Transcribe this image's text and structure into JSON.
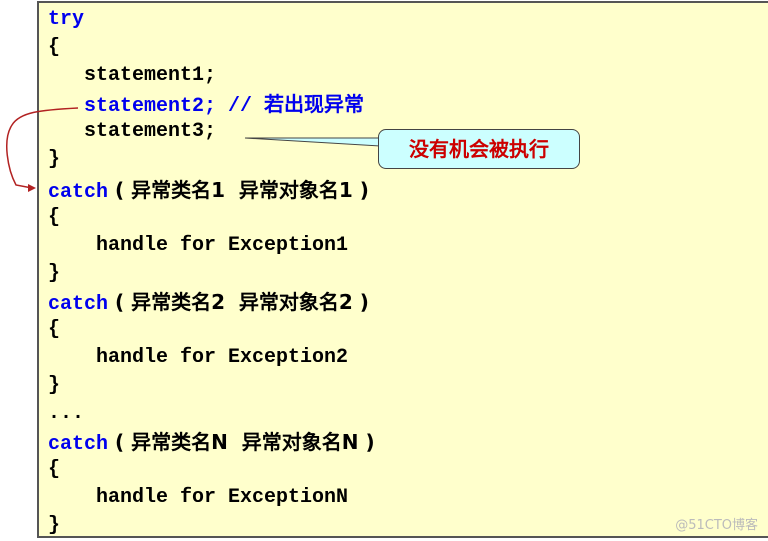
{
  "code": {
    "lines": [
      {
        "text": "try",
        "style": "keyword"
      },
      {
        "text": "{"
      },
      {
        "text": "   statement1;"
      },
      {
        "text": "   statement2; // ",
        "comment": "若出现异常",
        "style": "highlight"
      },
      {
        "text": "   statement3;"
      },
      {
        "text": "}"
      },
      {
        "kw": "catch",
        "rest": " ( 异常类名1  异常对象名1 )"
      },
      {
        "text": "{"
      },
      {
        "text": "    handle for Exception1"
      },
      {
        "text": "}"
      },
      {
        "kw": "catch",
        "rest": " ( 异常类名2  异常对象名2 )"
      },
      {
        "text": "{"
      },
      {
        "text": "    handle for Exception2"
      },
      {
        "text": "}"
      },
      {
        "text": "..."
      },
      {
        "kw": "catch",
        "rest": " ( 异常类名N  异常对象名N )"
      },
      {
        "text": "{"
      },
      {
        "text": "    handle for ExceptionN"
      },
      {
        "text": "}"
      }
    ]
  },
  "callout": {
    "text": "没有机会被执行"
  },
  "watermark": "@51CTO博客",
  "colors": {
    "keyword": "#0000ee",
    "callout_text": "#cc0000",
    "arrow": "#b22222",
    "background": "#ffffcc"
  }
}
